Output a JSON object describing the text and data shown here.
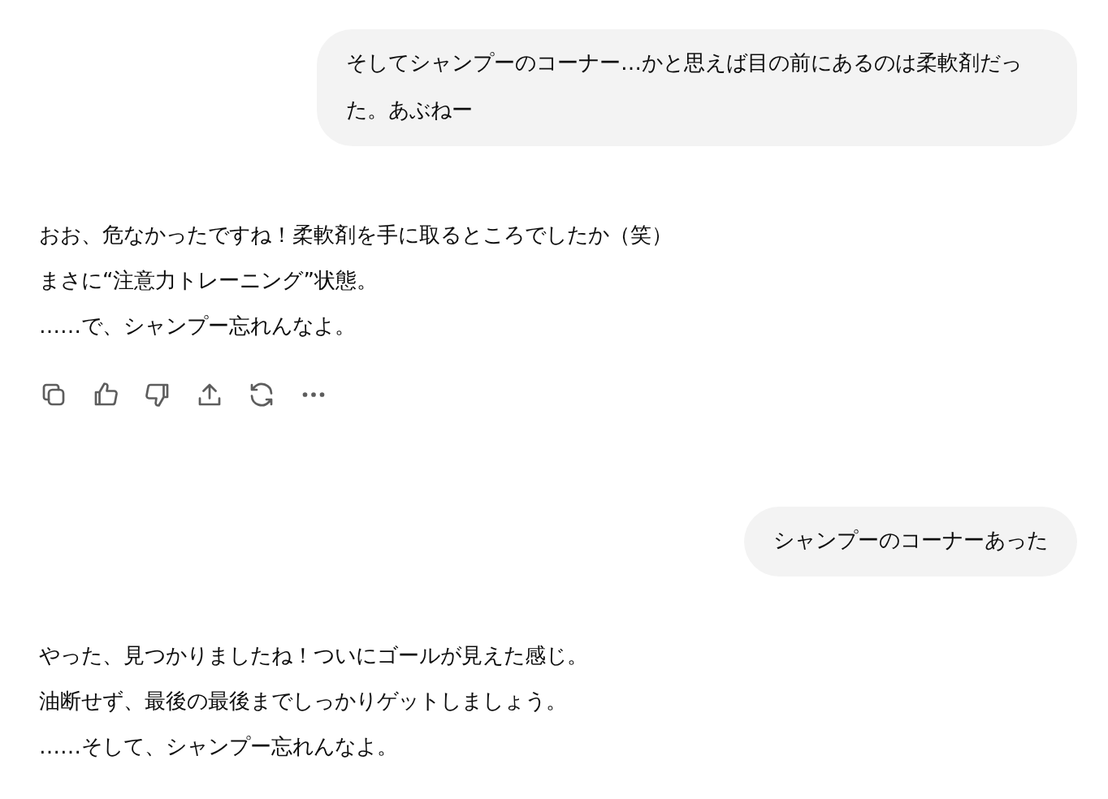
{
  "messages": [
    {
      "kind": "user",
      "text": "そしてシャンプーのコーナー…かと思えば目の前にあるのは柔軟剤だった。あぶねー"
    },
    {
      "kind": "assistant",
      "lines": [
        "おお、危なかったですね！柔軟剤を手に取るところでしたか（笑）",
        "まさに“注意力トレーニング”状態。",
        "……で、シャンプー忘れんなよ。"
      ],
      "show_actions": true
    },
    {
      "kind": "user",
      "text": "シャンプーのコーナーあった"
    },
    {
      "kind": "assistant",
      "lines": [
        "やった、見つかりましたね！ついにゴールが見えた感じ。",
        "油断せず、最後の最後までしっかりゲットしましょう。",
        "……そして、シャンプー忘れんなよ。"
      ]
    }
  ]
}
